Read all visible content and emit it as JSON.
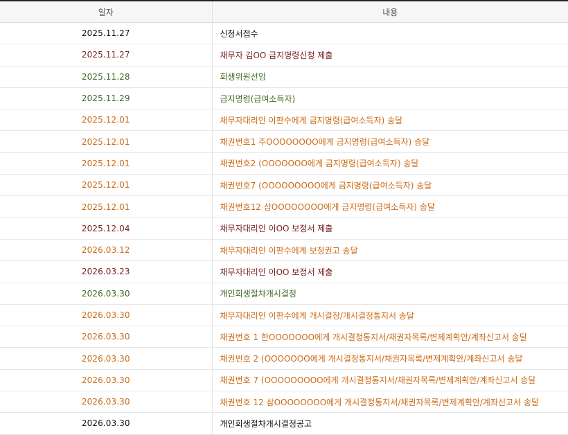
{
  "table": {
    "headers": {
      "date": "일자",
      "content": "내용"
    },
    "rows": [
      {
        "date": "2025.11.27",
        "content": "신청서접수",
        "color": "black"
      },
      {
        "date": "2025.11.27",
        "content": "채무자 김OO 금지명령신청 제출",
        "color": "maroon"
      },
      {
        "date": "2025.11.28",
        "content": "회생위원선임",
        "color": "green"
      },
      {
        "date": "2025.11.29",
        "content": "금지명령(급여소득자)",
        "color": "green"
      },
      {
        "date": "2025.12.01",
        "content": "채무자대리인 이판수에게 금지명령(급여소득자) 송달",
        "color": "orange"
      },
      {
        "date": "2025.12.01",
        "content": "채권번호1 주OOOOOOOO에게 금지명령(급여소득자) 송달",
        "color": "orange"
      },
      {
        "date": "2025.12.01",
        "content": "채권번호2 (OOOOOOO에게 금지명령(급여소득자) 송달",
        "color": "orange"
      },
      {
        "date": "2025.12.01",
        "content": "채권번호7 (OOOOOOOOO에게 금지명령(급여소득자) 송달",
        "color": "orange"
      },
      {
        "date": "2025.12.01",
        "content": "채권번호12 삼OOOOOOOO에게 금지명령(급여소득자) 송달",
        "color": "orange"
      },
      {
        "date": "2025.12.04",
        "content": "채무자대리인 이OO 보정서 제출",
        "color": "maroon"
      },
      {
        "date": "2026.03.12",
        "content": "채무자대리인 이판수에게 보정권고 송달",
        "color": "orange"
      },
      {
        "date": "2026.03.23",
        "content": "채무자대리인 이OO 보정서 제출",
        "color": "maroon"
      },
      {
        "date": "2026.03.30",
        "content": "개인회생절차개시결정",
        "color": "green"
      },
      {
        "date": "2026.03.30",
        "content": "채무자대리인 이판수에게 개시결정/개시결정통지서 송달",
        "color": "orange"
      },
      {
        "date": "2026.03.30",
        "content": "채권번호 1 한OOOOOOO에게 개시결정통지서/채권자목록/변제계획안/계좌신고서 송달",
        "color": "orange"
      },
      {
        "date": "2026.03.30",
        "content": "채권번호 2 (OOOOOOO에게 개시결정통지서/채권자목록/변제계획안/계좌신고서 송달",
        "color": "orange"
      },
      {
        "date": "2026.03.30",
        "content": "채권번호 7 (OOOOOOOOO에게 개시결정통지서/채권자목록/변제계획안/계좌신고서 송달",
        "color": "orange"
      },
      {
        "date": "2026.03.30",
        "content": "채권번호 12 삼OOOOOOOO에게 개시결정통지서/채권자목록/변제계획안/계좌신고서 송달",
        "color": "orange"
      },
      {
        "date": "2026.03.30",
        "content": "개인회생절차개시결정공고",
        "color": "black"
      }
    ]
  },
  "colors": {
    "black": "#111111",
    "maroon": "#7a1e1e",
    "green": "#3b6b22",
    "orange": "#cc6a14",
    "header_bg": "#f6f6f6",
    "top_border": "#222222"
  }
}
